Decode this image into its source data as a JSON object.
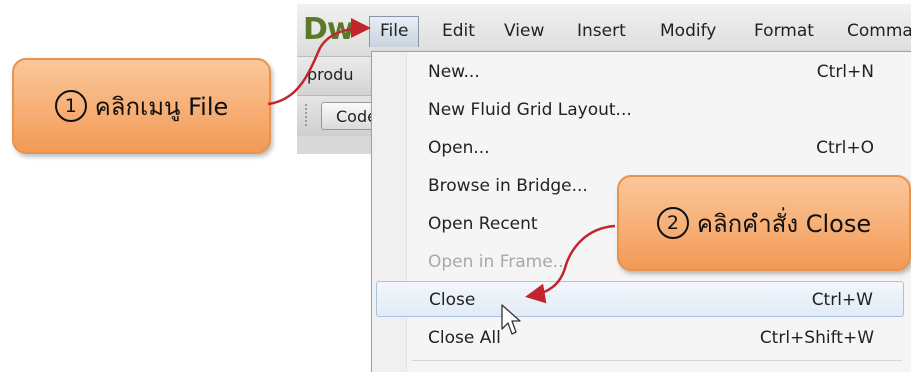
{
  "app": {
    "logo": "Dw",
    "document_tab": "produ",
    "code_button": "Code"
  },
  "menubar": {
    "items": [
      "File",
      "Edit",
      "View",
      "Insert",
      "Modify",
      "Format",
      "Comma"
    ],
    "active": "File"
  },
  "file_menu": {
    "items": [
      {
        "label": "New...",
        "shortcut": "Ctrl+N"
      },
      {
        "label": "New Fluid Grid Layout...",
        "shortcut": ""
      },
      {
        "label": "Open...",
        "shortcut": "Ctrl+O"
      },
      {
        "label": "Browse in Bridge...",
        "shortcut": ""
      },
      {
        "label": "Open Recent",
        "shortcut": ""
      },
      {
        "label": "Open in Frame...",
        "shortcut": ""
      },
      {
        "label": "Close",
        "shortcut": "Ctrl+W"
      },
      {
        "label": "Close All",
        "shortcut": "Ctrl+Shift+W"
      }
    ],
    "highlighted": "Close",
    "disabled": [
      "Open in Frame..."
    ]
  },
  "callouts": {
    "step1": {
      "number": "1",
      "text": "คลิกเมนู File"
    },
    "step2": {
      "number": "2",
      "text": "คลิกคำสั่ง Close"
    }
  },
  "colors": {
    "callout_fill": "#f39a56",
    "arrow": "#c0262c",
    "menu_highlight": "#e1eaf6",
    "logo": "#5a7a2a"
  }
}
